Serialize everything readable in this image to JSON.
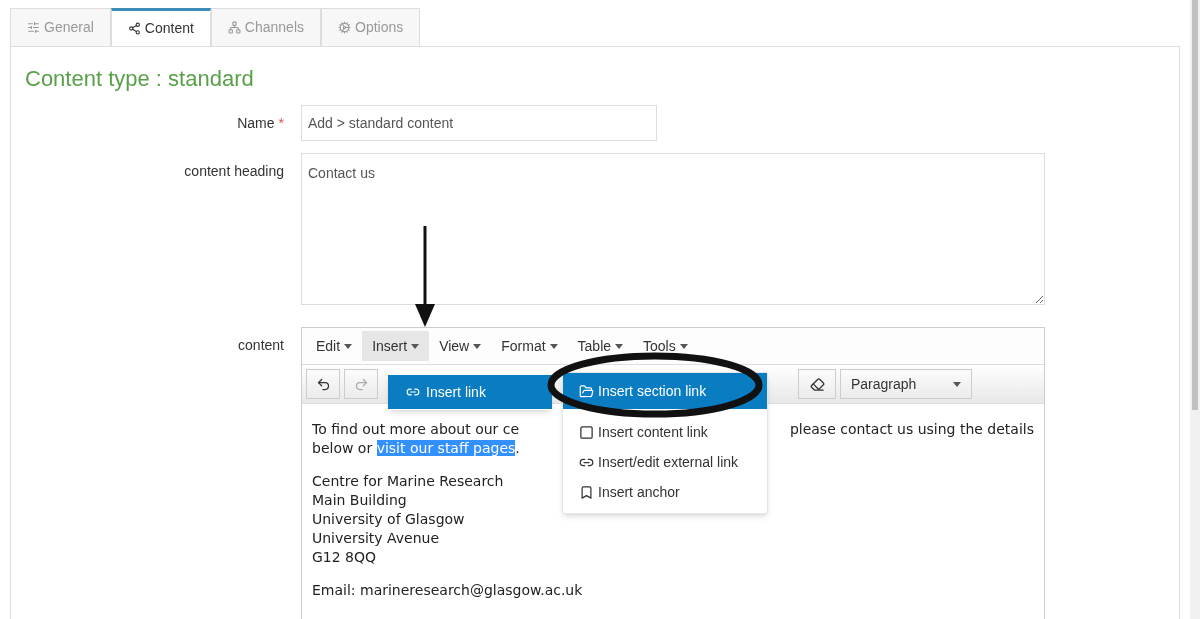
{
  "tabs": [
    {
      "label": "General",
      "selected": false
    },
    {
      "label": "Content",
      "selected": true
    },
    {
      "label": "Channels",
      "selected": false
    },
    {
      "label": "Options",
      "selected": false
    }
  ],
  "heading": "Content type : standard",
  "fields": [
    {
      "label": "Name",
      "required_mark": "*",
      "value": "Add > standard content"
    },
    {
      "label": "content heading",
      "value": "Contact us"
    }
  ],
  "editor": {
    "label": "content",
    "menubar": [
      {
        "label": "Edit",
        "selected": false
      },
      {
        "label": "Insert",
        "selected": true
      },
      {
        "label": "View",
        "selected": false
      },
      {
        "label": "Format",
        "selected": false
      },
      {
        "label": "Table",
        "selected": false
      },
      {
        "label": "Tools",
        "selected": false
      }
    ],
    "block_format": "Paragraph",
    "insert_menu": [
      {
        "label": "Insert link",
        "selected": true
      }
    ],
    "submenu": [
      {
        "label": "Insert section link",
        "selected": true
      },
      {
        "label": "Insert content link",
        "selected": false
      },
      {
        "label": "Insert/edit external link",
        "selected": false
      },
      {
        "label": "Insert anchor",
        "selected": false
      }
    ],
    "body": {
      "line1_left": "To find out more about our ce",
      "line1_right": "please contact us using the details",
      "line2_before": "below or ",
      "line2_selected": "visit our staff pages",
      "line2_after": ".",
      "address": [
        "Centre for Marine Research",
        "Main Building",
        "University of Glasgow",
        "University Avenue",
        "G12 8QQ"
      ],
      "email": "Email: marineresearch@glasgow.ac.uk"
    }
  }
}
